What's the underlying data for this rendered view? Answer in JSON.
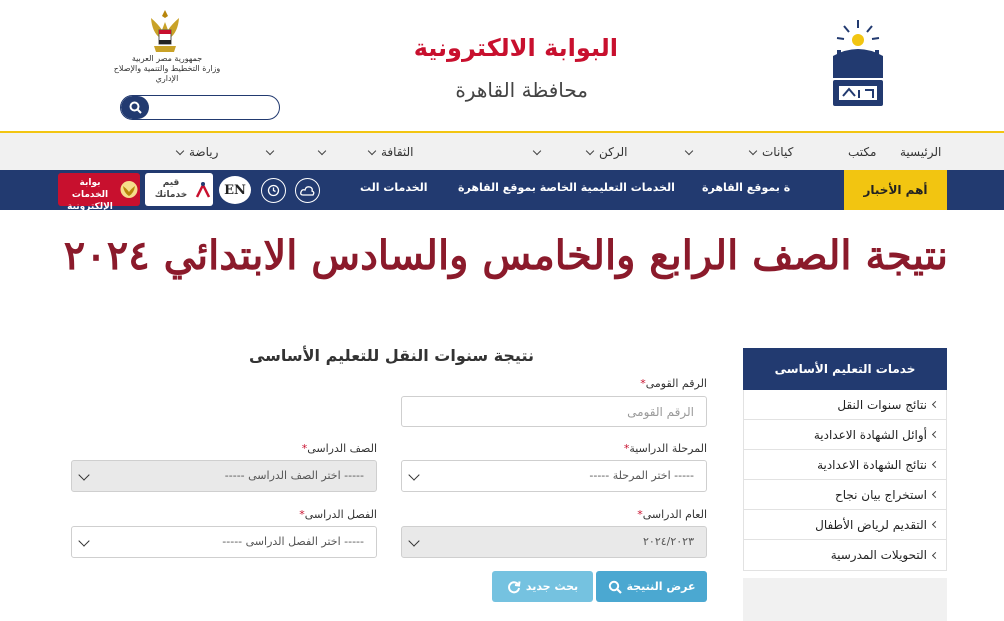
{
  "header": {
    "portal_title": "البوابة الالكترونية",
    "portal_subtitle": "محافظة القاهرة",
    "ministry_line1": "جمهورية مصر العربية",
    "ministry_line2": "وزارة التخطيط والتنمية والإصلاح الإداري",
    "search_placeholder": "",
    "brand_colors": {
      "primary": "#223a70",
      "accent": "#f2c511",
      "red": "#c8102e",
      "headline": "#8b1a2b"
    }
  },
  "nav": {
    "items": [
      {
        "label": "الرئيسية",
        "has_dropdown": false
      },
      {
        "label": "مكتب",
        "has_dropdown": true
      },
      {
        "label": "كيانات",
        "has_dropdown": true
      },
      {
        "label": "",
        "has_dropdown": true
      },
      {
        "label": "الركن",
        "has_dropdown": true
      },
      {
        "label": "",
        "has_dropdown": true
      },
      {
        "label": "الثقافة",
        "has_dropdown": true
      },
      {
        "label": "",
        "has_dropdown": true
      },
      {
        "label": "",
        "has_dropdown": true
      },
      {
        "label": "رياضة",
        "has_dropdown": true
      }
    ]
  },
  "newsbar": {
    "label": "أهم الأخبار",
    "ticker": [
      "ة بموقع القاهرة",
      "الخدمات التعليمية الخاصة بموقع القاهرة",
      "الخدمات الت"
    ],
    "en_label": "EN",
    "rate_label": "قيم خدماتك",
    "services_label": "بوابة الخدمات الإلكترونية",
    "icons": [
      "weather-icon",
      "clock-icon"
    ]
  },
  "headline": "نتيجة الصف الرابع والخامس والسادس الابتدائي ٢٠٢٤",
  "sidebar": {
    "title": "خدمات التعليم الأساسى",
    "items": [
      {
        "label": "نتائج سنوات النقل"
      },
      {
        "label": "أوائل الشهادة الاعدادية"
      },
      {
        "label": "نتائج الشهادة الاعدادية"
      },
      {
        "label": "استخراج بيان نجاح"
      },
      {
        "label": "التقديم لرياض الأطفال"
      },
      {
        "label": "التحويلات المدرسية"
      }
    ]
  },
  "form": {
    "title": "نتيجة سنوات النقل للتعليم الأساسى",
    "national_id": {
      "label": "الرقم القومى",
      "placeholder": "الرقم القومى",
      "value": ""
    },
    "stage": {
      "label": "المرحلة الدراسية",
      "selected": "----- اختر المرحلة -----"
    },
    "grade": {
      "label": "الصف الدراسى",
      "selected": "----- اختر الصف الدراسى -----"
    },
    "year": {
      "label": "العام الدراسى",
      "selected": "٢٠٢٤/٢٠٢٣"
    },
    "term": {
      "label": "الفصل الدراسى",
      "selected": "----- اختر الفصل الدراسى -----"
    },
    "required_mark": "*",
    "show_button": "عرض النتيجة",
    "new_search_button": "بحث جديد"
  }
}
